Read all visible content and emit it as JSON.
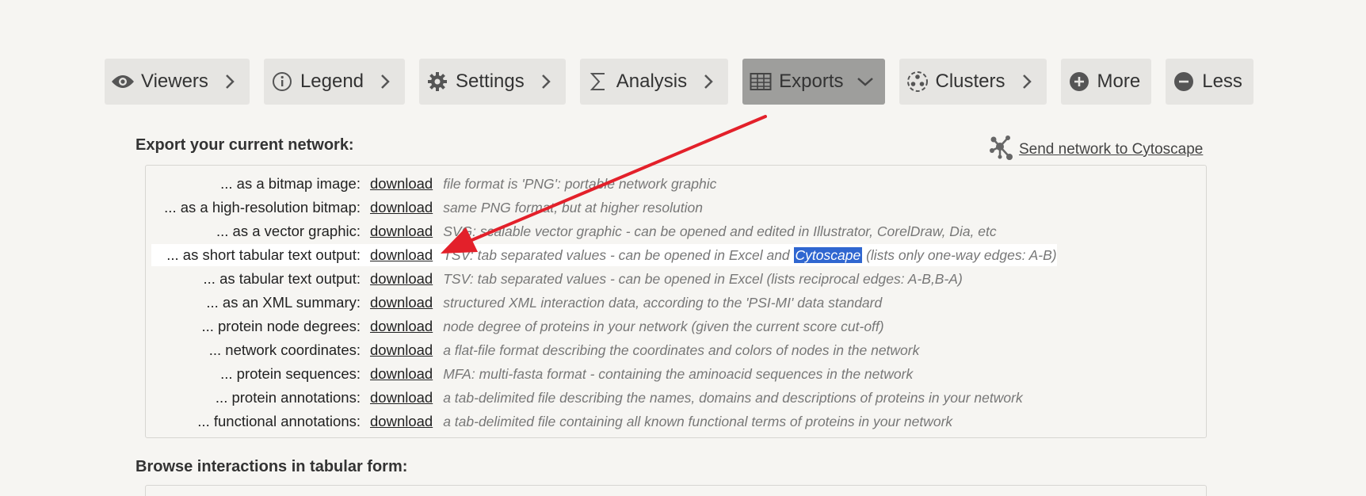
{
  "toolbar": {
    "buttons": [
      {
        "label": "Viewers",
        "icon": "eye-icon"
      },
      {
        "label": "Legend",
        "icon": "info-icon"
      },
      {
        "label": "Settings",
        "icon": "gear-icon"
      },
      {
        "label": "Analysis",
        "icon": "sigma-icon"
      },
      {
        "label": "Exports",
        "icon": "table-icon",
        "active": true
      },
      {
        "label": "Clusters",
        "icon": "clusters-icon"
      },
      {
        "label": "More",
        "icon": "plus-circle-icon"
      },
      {
        "label": "Less",
        "icon": "minus-circle-icon"
      }
    ]
  },
  "export_section": {
    "title": "Export your current network:",
    "send_link": "Send network to Cytoscape",
    "download_label": "download",
    "rows": [
      {
        "label": "... as a bitmap image:",
        "desc": "file format is 'PNG': portable network graphic"
      },
      {
        "label": "... as a high-resolution bitmap:",
        "desc": "same PNG format, but at higher resolution"
      },
      {
        "label": "... as a vector graphic:",
        "desc": "SVG: scalable vector graphic - can be opened and edited in Illustrator, CorelDraw, Dia, etc"
      },
      {
        "label": "... as short tabular text output:",
        "desc_before": "TSV: tab separated values - can be opened in Excel and ",
        "desc_selected": "Cytoscape",
        "desc_after": " (lists only one-way edges: A-B)"
      },
      {
        "label": "... as tabular text output:",
        "desc": "TSV: tab separated values - can be opened in Excel (lists reciprocal edges: A-B,B-A)"
      },
      {
        "label": "... as an XML summary:",
        "desc": "structured XML interaction data, according to the 'PSI-MI' data standard"
      },
      {
        "label": "... protein node degrees:",
        "desc": "node degree of proteins in your network (given the current score cut-off)"
      },
      {
        "label": "... network coordinates:",
        "desc": "a flat-file format describing the coordinates and colors of nodes in the network"
      },
      {
        "label": "... protein sequences:",
        "desc": "MFA: multi-fasta format - containing the aminoacid sequences in the network"
      },
      {
        "label": "... protein annotations:",
        "desc": "a tab-delimited file describing the names, domains and descriptions of proteins in your network"
      },
      {
        "label": "... functional annotations:",
        "desc": "a tab-delimited file containing all known functional terms of proteins in your network"
      }
    ]
  },
  "browse_section": {
    "title": "Browse interactions in tabular form:"
  },
  "colors": {
    "background": "#f6f5f2",
    "button": "#e6e5e2",
    "button_active": "#9e9e9c",
    "selection": "#2f66d0",
    "annotation_arrow": "#e3202a"
  }
}
